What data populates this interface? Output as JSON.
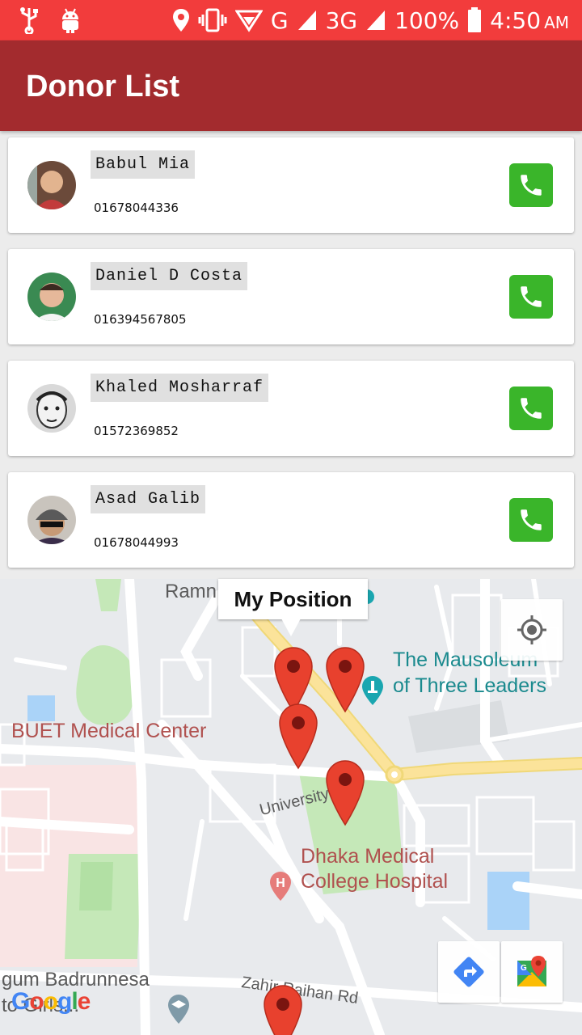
{
  "status_bar": {
    "battery": "100%",
    "network": "G",
    "network2": "3G",
    "time": "4:50",
    "ampm": "AM"
  },
  "app_bar": {
    "title": "Donor List"
  },
  "donors": [
    {
      "name": "Babul Mia",
      "phone": "01678044336"
    },
    {
      "name": "Daniel D Costa",
      "phone": "016394567805"
    },
    {
      "name": "Khaled Mosharraf",
      "phone": "01572369852"
    },
    {
      "name": "Asad Galib",
      "phone": "01678044993"
    }
  ],
  "map": {
    "info_window": "My Position",
    "labels": {
      "ramna": "Ramn",
      "mausoleum": "The Mausoleum\nof Three Leaders",
      "buet": "BUET Medical Center",
      "university_st": "University St",
      "dhaka_medical": "Dhaka Medical\nCollege Hospital",
      "zahir_rd": "Zahir Raihan Rd",
      "badrunnesa": "gum Badrunnesa\nto    Girls...",
      "google": "Google"
    },
    "colors": {
      "road_major": "#fbe39a",
      "park": "#c5e8b8",
      "water": "#aad3f8",
      "marker": "#e8412e"
    }
  }
}
